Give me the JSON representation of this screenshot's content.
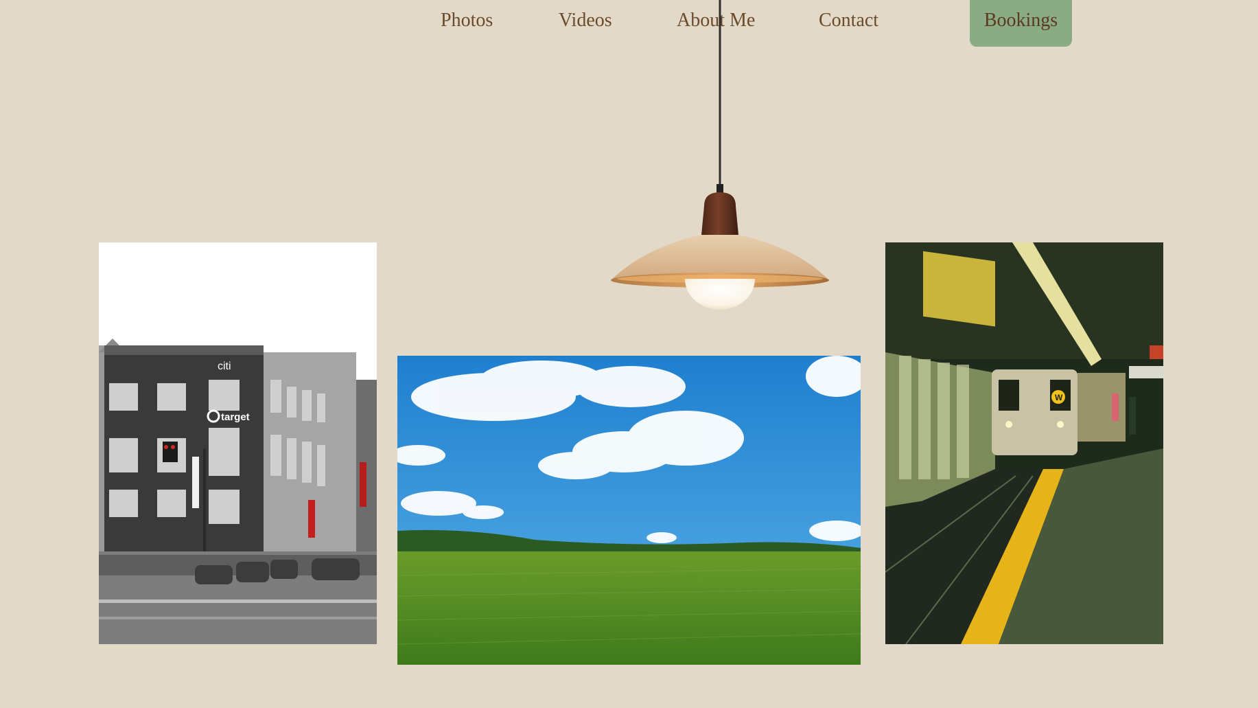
{
  "nav": {
    "items": [
      {
        "label": "Photos"
      },
      {
        "label": "Videos"
      },
      {
        "label": "About Me"
      },
      {
        "label": "Contact"
      }
    ],
    "cta_label": "Bookings"
  },
  "colors": {
    "background": "#e3d9c8",
    "nav_text": "#6b4a2b",
    "cta_background": "#8aab85"
  },
  "gallery": {
    "photos": [
      {
        "subject": "black-and-white city building"
      },
      {
        "subject": "green field under blue sky with clouds"
      },
      {
        "subject": "subway train at station platform"
      }
    ]
  },
  "building_signs": {
    "top": "citi",
    "store": "target"
  },
  "train_badge": "W"
}
